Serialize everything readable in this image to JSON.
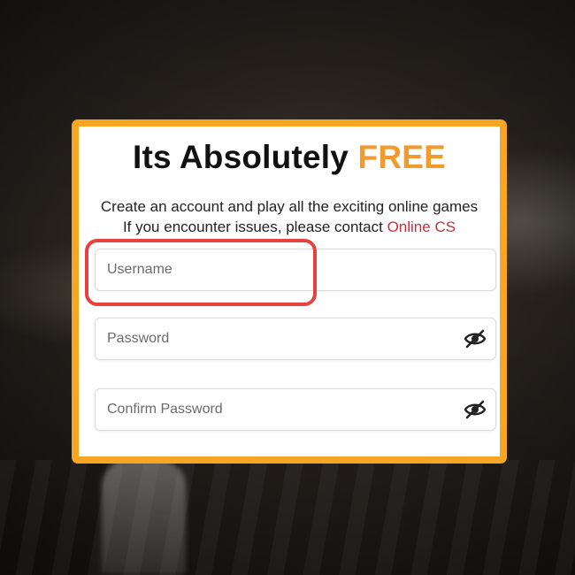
{
  "signup": {
    "title_main": "Its Absolutely",
    "title_accent": "FREE",
    "subtitle_line1": "Create an account and play all the exciting online games",
    "subtitle_line2_prefix": "If you encounter issues, please contact",
    "support_link": "Online CS"
  },
  "fields": {
    "username_placeholder": "Username",
    "password_placeholder": "Password",
    "confirm_password_placeholder": "Confirm Password",
    "password_icon": "eye-slash-icon",
    "confirm_password_icon": "eye-slash-icon"
  },
  "colors": {
    "border_accent": "#f6a623",
    "free_text": "#f29a2e",
    "support_link": "#c5303a",
    "highlight": "#e8403c"
  }
}
